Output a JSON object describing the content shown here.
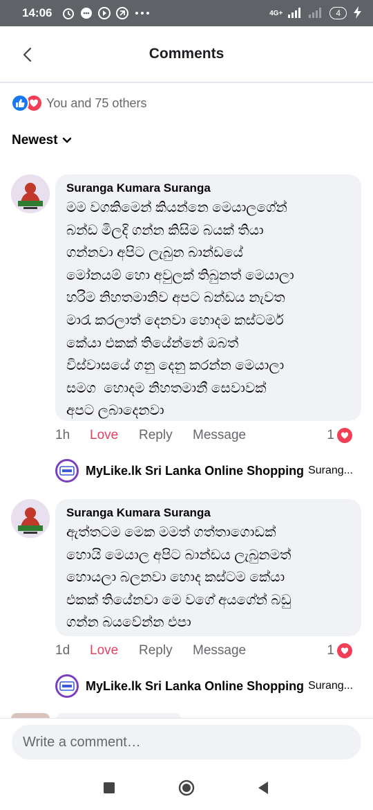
{
  "status_bar": {
    "time": "14:06",
    "network": "4G+",
    "battery": "4",
    "icons": [
      "alarm-icon",
      "chat-icon",
      "media-icon",
      "media-icon",
      "more-icon"
    ]
  },
  "header": {
    "title": "Comments",
    "back_icon": "chevron-left-icon"
  },
  "reactions": {
    "text": "You and 75 others",
    "icons": [
      "like-icon",
      "love-icon"
    ]
  },
  "sort": {
    "label": "Newest"
  },
  "comments": [
    {
      "author": "Suranga Kumara Suranga",
      "text": "මම වගකිමෙන් කියන්නෙ මෙයාලගේන්\nබන්ඩ මිලදි ගන්න කිසිම බයක් තියා\nගන්නවා අපිට ලැබුන බාන්ඩයේ\nමෝනයම් හො අවුලක් තිබුනත් මෙයාලා\nහරිම නිහතමානිව අපට බන්ඩය නැවත\nමාරැ කරලාත් දෙනවා හොදම කස්ටමර්\nකේයා එකක් තියේන්නේ ඔබත්\nවිස්වාසයේ ගනු දෙනු කරන්න මෙයාලා\nසමග  හොදම නිහතමානී සෙවාවක්\nඅපට ලබාදෙනවා",
      "time": "1h",
      "love": "Love",
      "reply": "Reply",
      "message": "Message",
      "reaction_count": "1",
      "reply_preview": {
        "name": "MyLike.lk Sri Lanka Online Shopping",
        "snippet": "Surang..."
      }
    },
    {
      "author": "Suranga Kumara Suranga",
      "text": "ඇත්තටම මෙක මමත් ගත්තාගොඩක්\nහොයි මෙයාල අපිට බාන්ඩය ලැබුනමත්\nහොයලා බලනවා හොද කස්ටම කේයා\nඑකක් තියේනවා මෙ වගේ අයගේන් බඩු\nගන්න බයවේන්න එපා",
      "time": "1d",
      "love": "Love",
      "reply": "Reply",
      "message": "Message",
      "reaction_count": "1",
      "reply_preview": {
        "name": "MyLike.lk Sri Lanka Online Shopping",
        "snippet": "Surang..."
      }
    }
  ],
  "composer": {
    "placeholder": "Write a comment…"
  },
  "nav": {
    "icons": [
      "recents-square-icon",
      "home-circle-icon",
      "back-triangle-icon"
    ]
  },
  "colors": {
    "love_red": "#e4405f",
    "like_blue": "#1877f2",
    "bubble_gray": "#f0f2f5",
    "status_bar": "#5f6368"
  }
}
